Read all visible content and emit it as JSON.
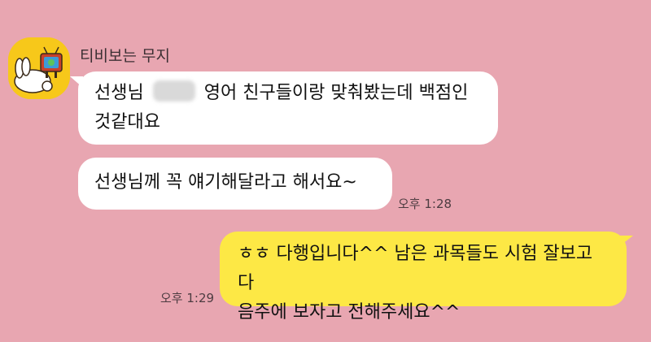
{
  "chat": {
    "sender_name": "티비보는 무지",
    "avatar_icon": "muzi-watching-tv-icon",
    "messages": [
      {
        "direction": "incoming",
        "line1_before": "선생님",
        "line1_after": "영어 친구들이랑 맞춰봤는데 백점인",
        "line2": "것같대요"
      },
      {
        "direction": "incoming",
        "text": "선생님께 꼭 얘기해달라고 해서요~",
        "time": "오후 1:28"
      },
      {
        "direction": "outgoing",
        "line1": "ㅎㅎ 다행입니다^^ 남은 과목들도 시험 잘보고 다",
        "line2": "음주에 보자고 전해주세요^^",
        "time": "오후 1:29"
      }
    ]
  },
  "colors": {
    "background": "#e8a6b1",
    "incoming_bubble": "#ffffff",
    "outgoing_bubble": "#fde845"
  }
}
